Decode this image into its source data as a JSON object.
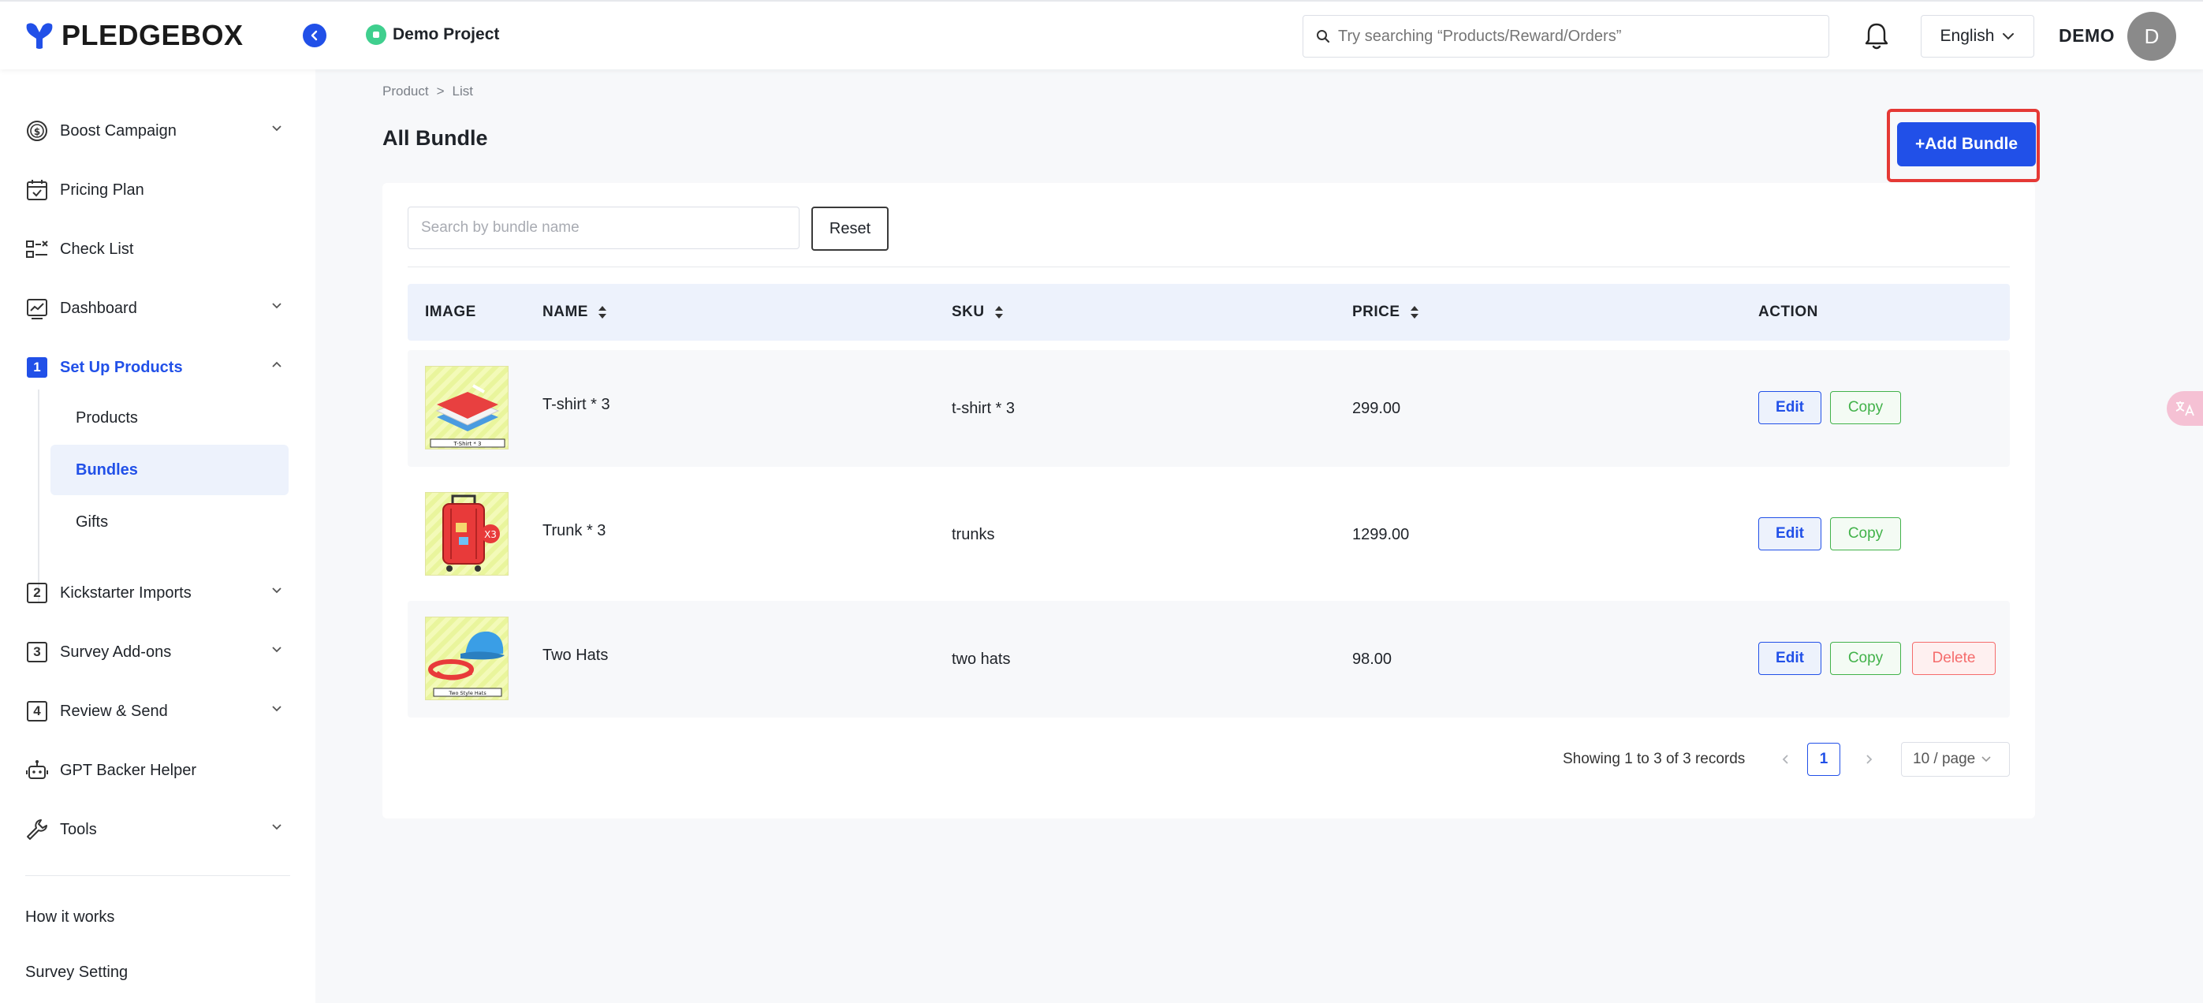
{
  "header": {
    "brand": "PLEDGEBOX",
    "project_name": "Demo Project",
    "search_placeholder": "Try searching “Products/Reward/Orders”",
    "language": "English",
    "user_name": "DEMO",
    "avatar_letter": "D"
  },
  "sidebar": {
    "items": [
      {
        "label": "Boost Campaign"
      },
      {
        "label": "Pricing Plan"
      },
      {
        "label": "Check List"
      },
      {
        "label": "Dashboard"
      },
      {
        "label": "Set Up Products",
        "step": "1"
      },
      {
        "label": "Kickstarter Imports",
        "step": "2"
      },
      {
        "label": "Survey Add-ons",
        "step": "3"
      },
      {
        "label": "Review & Send",
        "step": "4"
      },
      {
        "label": "GPT Backer Helper"
      },
      {
        "label": "Tools"
      }
    ],
    "sub_items": [
      {
        "label": "Products"
      },
      {
        "label": "Bundles"
      },
      {
        "label": "Gifts"
      }
    ],
    "footer_links": [
      {
        "label": "How it works"
      },
      {
        "label": "Survey Setting"
      }
    ]
  },
  "main": {
    "breadcrumb": [
      "Product",
      ">",
      "List"
    ],
    "title": "All Bundle",
    "add_button": "+Add Bundle",
    "search_placeholder": "Search by bundle name",
    "reset_label": "Reset",
    "columns": [
      "IMAGE",
      "NAME",
      "SKU",
      "PRICE",
      "ACTION"
    ],
    "rows": [
      {
        "name": "T-shirt * 3",
        "sku": "t-shirt * 3",
        "price": "299.00",
        "thumb_caption": "T-Shirt * 3"
      },
      {
        "name": "Trunk * 3",
        "sku": "trunks",
        "price": "1299.00",
        "thumb_caption": "X3"
      },
      {
        "name": "Two Hats",
        "sku": "two hats",
        "price": "98.00",
        "thumb_caption": "Two Style Hats"
      }
    ],
    "actions": {
      "edit": "Edit",
      "copy": "Copy",
      "delete": "Delete"
    },
    "pagination": {
      "records": "Showing 1 to 3 of 3 records",
      "current_page": "1",
      "page_size": "10 / page"
    }
  },
  "colors": {
    "primary": "#2150e8",
    "highlight_red": "#e53935",
    "copy_green": "#42b24a",
    "delete_red": "#f56c6c"
  }
}
